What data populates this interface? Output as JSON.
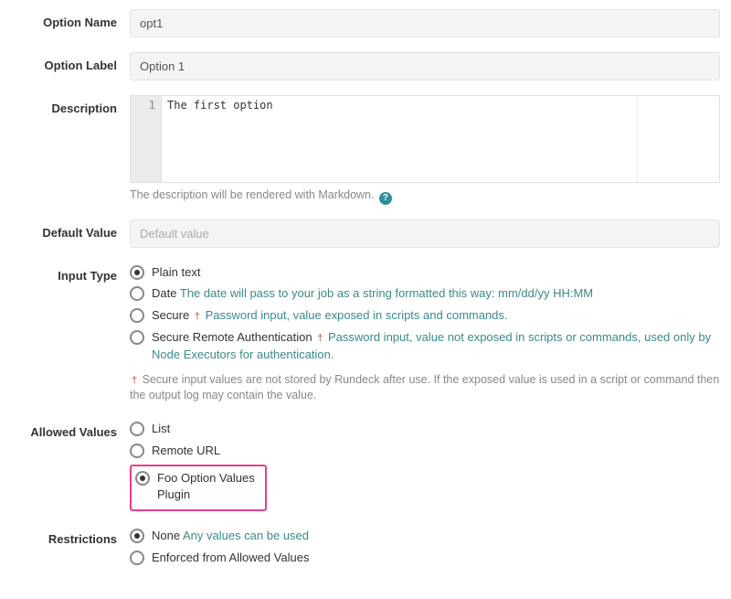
{
  "labels": {
    "optionName": "Option Name",
    "optionLabel": "Option Label",
    "description": "Description",
    "defaultValue": "Default Value",
    "inputType": "Input Type",
    "allowedValues": "Allowed Values",
    "restrictions": "Restrictions"
  },
  "fields": {
    "optionName": {
      "value": "opt1"
    },
    "optionLabel": {
      "value": "Option 1"
    },
    "description": {
      "lineNo": "1",
      "text": "The first option"
    },
    "defaultValue": {
      "placeholder": "Default value",
      "value": ""
    }
  },
  "descriptionHint": {
    "text": "The description will be rendered with Markdown.",
    "iconGlyph": "?"
  },
  "inputType": {
    "options": {
      "plain": {
        "label": "Plain text",
        "selected": true
      },
      "date": {
        "label": "Date",
        "helper": "The date will pass to your job as a string formatted this way: mm/dd/yy HH:MM",
        "selected": false
      },
      "secure": {
        "label": "Secure",
        "cross": "†",
        "helper": "Password input, value exposed in scripts and commands.",
        "selected": false
      },
      "secureRemote": {
        "label": "Secure Remote Authentication",
        "cross": "†",
        "helper": "Password input, value not exposed in scripts or commands, used only by Node Executors for authentication.",
        "selected": false
      }
    },
    "footnote": {
      "cross": "†",
      "text": "Secure input values are not stored by Rundeck after use. If the exposed value is used in a script or command then the output log may contain the value."
    }
  },
  "allowedValues": {
    "list": {
      "label": "List",
      "selected": false
    },
    "remote": {
      "label": "Remote URL",
      "selected": false
    },
    "plugin": {
      "label": "Foo Option Values Plugin",
      "selected": true
    }
  },
  "restrictions": {
    "none": {
      "label": "None",
      "helper": "Any values can be used",
      "selected": true
    },
    "enforced": {
      "label": "Enforced from Allowed Values",
      "selected": false
    }
  }
}
